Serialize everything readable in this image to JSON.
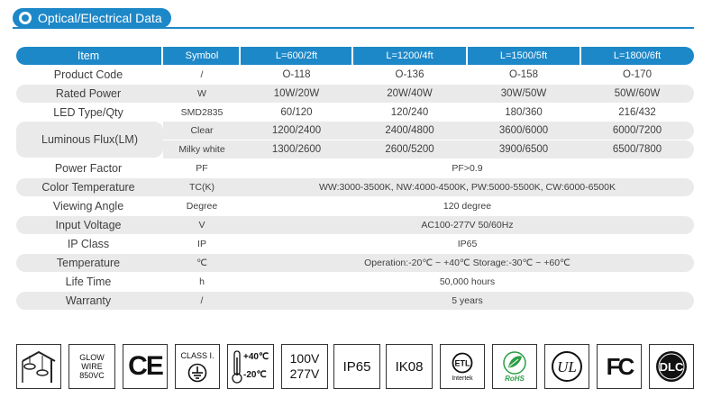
{
  "section_title": "Optical/Electrical Data",
  "table": {
    "headers": [
      "Item",
      "Symbol",
      "L=600/2ft",
      "L=1200/4ft",
      "L=1500/5ft",
      "L=1800/6ft"
    ],
    "rows": [
      {
        "item": "Product Code",
        "symbol": "/",
        "values": [
          "O-118",
          "O-136",
          "O-158",
          "O-170"
        ]
      },
      {
        "item": "Rated Power",
        "symbol": "W",
        "values": [
          "10W/20W",
          "20W/40W",
          "30W/50W",
          "50W/60W"
        ]
      },
      {
        "item": "LED Type/Qty",
        "symbol": "SMD2835",
        "values": [
          "60/120",
          "120/240",
          "180/360",
          "216/432"
        ]
      },
      {
        "item": "Power Factor",
        "symbol": "PF",
        "value": "PF>0.9"
      },
      {
        "item": "Color Temperature",
        "symbol": "TC(K)",
        "value": "WW:3000-3500K, NW:4000-4500K, PW:5000-5500K, CW:6000-6500K"
      },
      {
        "item": "Viewing Angle",
        "symbol": "Degree",
        "value": "120 degree"
      },
      {
        "item": "Input Voltage",
        "symbol": "V",
        "value": "AC100-277V 50/60Hz"
      },
      {
        "item": "IP Class",
        "symbol": "IP",
        "value": "IP65"
      },
      {
        "item": "Temperature",
        "symbol": "℃",
        "value": "Operation:-20℃ ~ +40℃  Storage:-30℃ ~ +60℃"
      },
      {
        "item": "Life Time",
        "symbol": "h",
        "value": "50,000 hours"
      },
      {
        "item": "Warranty",
        "symbol": "/",
        "value": "5 years"
      }
    ],
    "luminous": {
      "item": "Luminous Flux(LM)",
      "clear": {
        "symbol": "Clear",
        "values": [
          "1200/2400",
          "2400/4800",
          "3600/6000",
          "6000/7200"
        ]
      },
      "milky": {
        "symbol": "Milky white",
        "values": [
          "1300/2600",
          "2600/5200",
          "3900/6500",
          "6500/7800"
        ]
      }
    }
  },
  "certifications": {
    "glow_wire": [
      "GLOW",
      "WIRE",
      "850VC"
    ],
    "ce": "CE",
    "class": "CLASS I.",
    "temp_high": "+40℃",
    "temp_low": "-20℃",
    "voltage": [
      "100V",
      "277V"
    ],
    "ip": "IP65",
    "ik": "IK08",
    "intertek": "Intertek",
    "rohs": "RoHS",
    "ul": "UL",
    "fc": "FC",
    "dlc": "DLC"
  },
  "colors": {
    "accent": "#1d88c8",
    "row_shade": "#eaeaea"
  },
  "icons": [
    "hanging-lamp-icon",
    "ground-symbol-icon",
    "thermometer-icon",
    "etl-icon",
    "rohs-leaf-icon",
    "ul-icon",
    "dlc-icon"
  ]
}
